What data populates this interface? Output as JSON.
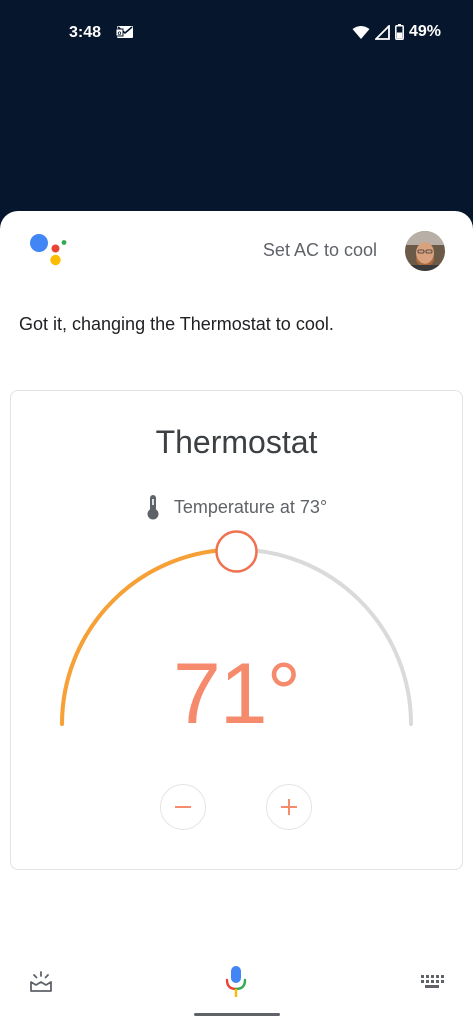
{
  "status_bar": {
    "time": "3:48",
    "battery_text": "49%",
    "icons": [
      "mail-notification-icon",
      "wifi-icon",
      "cellular-signal-icon",
      "battery-icon"
    ]
  },
  "assistant": {
    "query": "Set AC to cool",
    "response": "Got it, changing the Thermostat to cool."
  },
  "thermostat": {
    "title": "Thermostat",
    "ambient_text": "Temperature at 73°",
    "setpoint_text": "71°",
    "dial_level": 0.5,
    "mode": "cool",
    "colors": {
      "active_arc": "#f7a035",
      "inactive_arc": "#dadada",
      "setpoint": "#f58a6c"
    }
  },
  "bottom_bar": {
    "icons": [
      "explore-icon",
      "mic-icon",
      "keyboard-icon"
    ]
  }
}
